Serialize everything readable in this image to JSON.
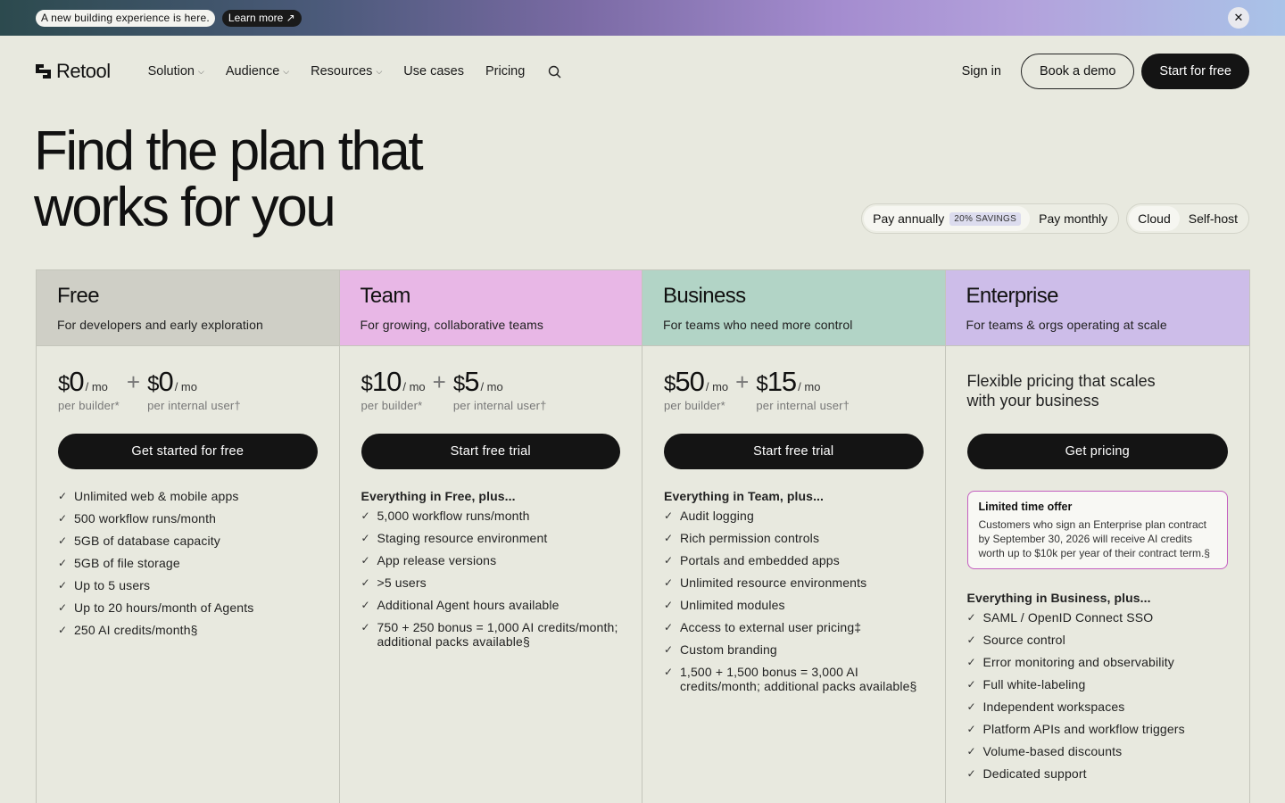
{
  "banner": {
    "message": "A new building experience is here.",
    "link_label": "Learn more ↗",
    "close_glyph": "✕"
  },
  "nav": {
    "brand": "Retool",
    "links": [
      {
        "label": "Solution",
        "dropdown": true
      },
      {
        "label": "Audience",
        "dropdown": true
      },
      {
        "label": "Resources",
        "dropdown": true
      },
      {
        "label": "Use cases",
        "dropdown": false
      },
      {
        "label": "Pricing",
        "dropdown": false
      }
    ],
    "caret": "⌵",
    "sign_in": "Sign in",
    "book_demo": "Book a demo",
    "start_free": "Start for free"
  },
  "hero": {
    "title_line1": "Find the plan that",
    "title_line2": "works for you"
  },
  "toggles": {
    "billing": {
      "annual": "Pay annually",
      "savings": "20% SAVINGS",
      "monthly": "Pay monthly",
      "selected": "annual"
    },
    "hosting": {
      "cloud": "Cloud",
      "selfhost": "Self-host",
      "selected": "cloud"
    }
  },
  "plans": [
    {
      "name": "Free",
      "subtitle": "For developers and early exploration",
      "color": "#cfcfc6",
      "builder_price": "0",
      "user_price": "0",
      "per": "/ mo",
      "builder_label": "per builder*",
      "user_label": "per internal user†",
      "cta": "Get started for free",
      "intro": "",
      "features": [
        "Unlimited web & mobile apps",
        "500 workflow runs/month",
        "5GB of database capacity",
        "5GB of file storage",
        "Up to 5 users",
        "Up to 20 hours/month of Agents",
        "250 AI credits/month§"
      ]
    },
    {
      "name": "Team",
      "subtitle": "For growing, collaborative teams",
      "color": "#e8b7e6",
      "builder_price": "10",
      "user_price": "5",
      "per": "/ mo",
      "builder_label": "per builder*",
      "user_label": "per internal user†",
      "cta": "Start free trial",
      "intro": "Everything in Free, plus...",
      "features": [
        "5,000 workflow runs/month",
        "Staging resource environment",
        "App release versions",
        ">5 users",
        "Additional Agent hours available",
        "750 + 250 bonus = 1,000 AI credits/month; additional packs available§"
      ]
    },
    {
      "name": "Business",
      "subtitle": "For teams who need more control",
      "color": "#b2d4c6",
      "builder_price": "50",
      "user_price": "15",
      "per": "/ mo",
      "builder_label": "per builder*",
      "user_label": "per internal user†",
      "cta": "Start free trial",
      "intro": "Everything in Team, plus...",
      "features": [
        "Audit logging",
        "Rich permission controls",
        "Portals and embedded apps",
        "Unlimited resource environments",
        "Unlimited modules",
        "Access to external user pricing‡",
        "Custom branding",
        "1,500 + 1,500 bonus = 3,000 AI credits/month; additional packs available§"
      ]
    },
    {
      "name": "Enterprise",
      "subtitle": "For teams & orgs operating at scale",
      "color": "#cdbde9",
      "heading": "Flexible pricing that scales with your business",
      "cta": "Get pricing",
      "offer_title": "Limited time offer",
      "offer_text": "Customers who sign an Enterprise plan contract by September 30, 2026 will receive AI credits worth up to $10k per year of their contract term.§",
      "intro": "Everything in Business, plus...",
      "features": [
        "SAML / OpenID Connect SSO",
        "Source control",
        "Error monitoring and observability",
        "Full white-labeling",
        "Independent workspaces",
        "Platform APIs and workflow triggers",
        "Volume-based discounts",
        "Dedicated support"
      ]
    }
  ],
  "symbols": {
    "dollar": "$",
    "plus": "+",
    "check": "✓"
  }
}
